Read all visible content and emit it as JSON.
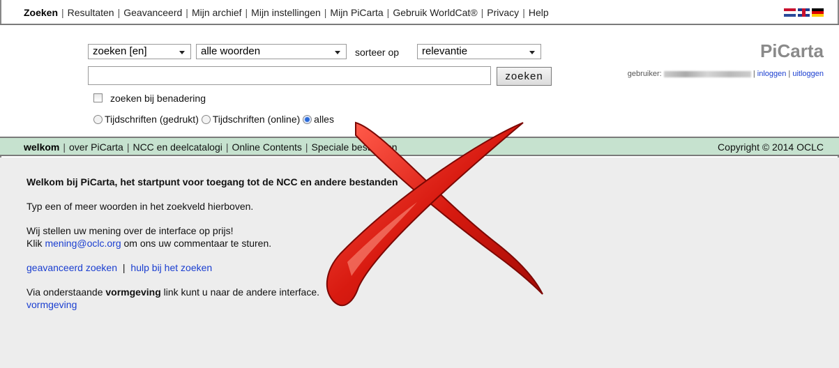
{
  "nav": {
    "items": [
      "Zoeken",
      "Resultaten",
      "Geavanceerd",
      "Mijn archief",
      "Mijn instellingen",
      "Mijn PiCarta",
      "Gebruik WorldCat®",
      "Privacy",
      "Help"
    ]
  },
  "search": {
    "field_select": "zoeken [en]",
    "words_select": "alle woorden",
    "sort_label": "sorteer op",
    "sort_select": "relevantie",
    "query_value": "",
    "search_button": "zoeken",
    "approx_label": "zoeken bij benadering",
    "radio_options": [
      "Tijdschriften (gedrukt)",
      "Tijdschriften (online)",
      "alles"
    ],
    "radio_selected": "alles"
  },
  "brand": {
    "title": "PiCarta",
    "user_label": "gebruiker:",
    "login": "inloggen",
    "logout": "uitloggen"
  },
  "bar": {
    "items": [
      "welkom",
      "over PiCarta",
      "NCC en deelcatalogi",
      "Online Contents",
      "Speciale bestanden"
    ],
    "copyright": "Copyright © 2014 OCLC"
  },
  "content": {
    "heading": "Welkom bij PiCarta, het startpunt voor toegang tot de NCC en andere bestanden",
    "instruction": "Typ een of meer woorden in het zoekveld hierboven.",
    "feedback_line1": "Wij stellen uw mening over de interface op prijs!",
    "feedback_pre": "Klik ",
    "feedback_email": "mening@oclc.org",
    "feedback_post": " om ons uw commentaar te sturen.",
    "link_advanced": "geavanceerd zoeken",
    "link_help": "hulp bij het zoeken",
    "via_pre": "Via onderstaande ",
    "via_bold": "vormgeving",
    "via_post": " link kunt u naar de andere interface.",
    "link_design": "vormgeving"
  }
}
